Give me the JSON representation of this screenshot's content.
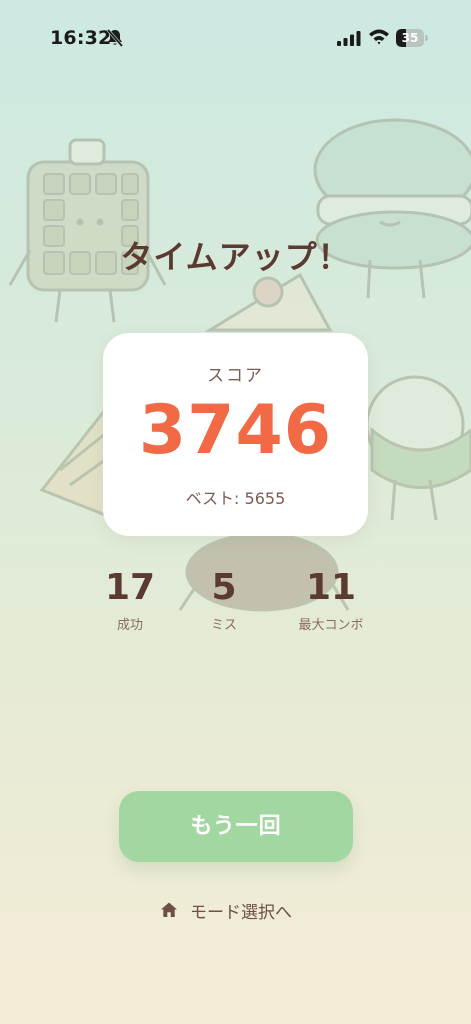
{
  "status_bar": {
    "time": "16:32",
    "battery_level": "35",
    "battery_fraction": 0.35,
    "icons": [
      "bell-slash-icon",
      "cellular-signal-icon",
      "wifi-icon",
      "battery-icon"
    ]
  },
  "result": {
    "title": "タイムアップ！"
  },
  "score_card": {
    "label": "スコア",
    "score": "3746",
    "best": "ベスト: 5655"
  },
  "stats": {
    "success": {
      "value": "17",
      "label": "成功"
    },
    "miss": {
      "value": "5",
      "label": "ミス"
    },
    "max_combo": {
      "value": "11",
      "label": "最大コンボ"
    }
  },
  "actions": {
    "retry_label": "もう一回",
    "mode_select_label": "モード選択へ",
    "mode_select_icon": "home-icon"
  },
  "colors": {
    "score_accent": "#f26a45",
    "retry_button": "#a3d7a2",
    "title_text": "#5b3a31"
  },
  "background_illustrations": [
    "waffle",
    "macaron",
    "cake-slice",
    "pie-slice",
    "matcha-mochi",
    "chocolate-cookie"
  ]
}
